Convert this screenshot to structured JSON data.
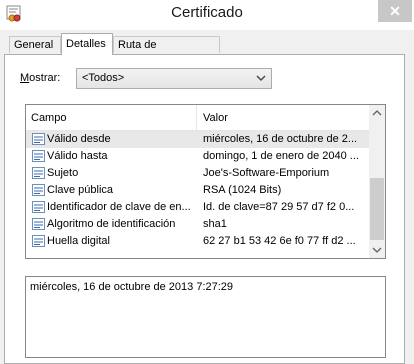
{
  "window": {
    "title": "Certificado",
    "close_label": "✕"
  },
  "tabs": [
    {
      "label": "General"
    },
    {
      "label": "Detalles"
    },
    {
      "label": "Ruta de certificación"
    }
  ],
  "filter": {
    "label_prefix": "M",
    "label_rest": "ostrar:",
    "selected": "<Todos>"
  },
  "list": {
    "header": {
      "field": "Campo",
      "value": "Valor"
    },
    "rows": [
      {
        "field": "Válido desde",
        "value": "miércoles, 16 de octubre de 2..."
      },
      {
        "field": "Válido hasta",
        "value": "domingo, 1 de enero de 2040 ..."
      },
      {
        "field": "Sujeto",
        "value": "Joe's-Software-Emporium"
      },
      {
        "field": "Clave pública",
        "value": "RSA (1024 Bits)"
      },
      {
        "field": "Identificador de clave de en...",
        "value": "Id. de clave=87 29 57 d7 f2 0..."
      },
      {
        "field": "Algoritmo de identificación",
        "value": "sha1"
      },
      {
        "field": "Huella digital",
        "value": "62 27 b1 53 42 6e f0 77 ff d2 ..."
      }
    ]
  },
  "detail": {
    "text": "miércoles, 16 de octubre de 2013 7:27:29"
  },
  "colors": {
    "selection": "#e8e8e8",
    "close_button": "#c7c7c7",
    "icon_accent": "#3a6cb5"
  }
}
